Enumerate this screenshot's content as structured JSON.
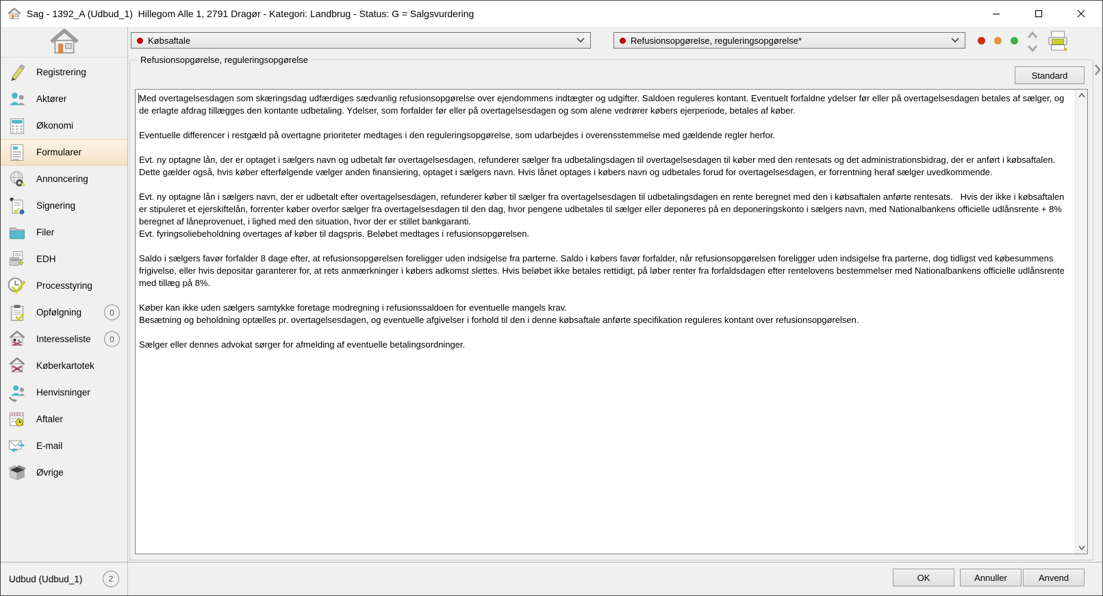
{
  "window": {
    "title": "Sag - 1392_A (Udbud_1)  Hillegom Alle 1, 2791 Dragør - Kategori: Landbrug - Status: G = Salgsvurdering"
  },
  "sidebar": {
    "items": [
      {
        "label": "Registrering",
        "icon": "pen-icon"
      },
      {
        "label": "Aktører",
        "icon": "people-icon"
      },
      {
        "label": "Økonomi",
        "icon": "calculator-icon"
      },
      {
        "label": "Formularer",
        "icon": "form-icon",
        "selected": true
      },
      {
        "label": "Annoncering",
        "icon": "globe-gear-icon"
      },
      {
        "label": "Signering",
        "icon": "signature-icon"
      },
      {
        "label": "Filer",
        "icon": "folder-icon"
      },
      {
        "label": "EDH",
        "icon": "printer-doc-icon"
      },
      {
        "label": "Processtyring",
        "icon": "clock-check-icon"
      },
      {
        "label": "Opfølgning",
        "icon": "clipboard-check-icon",
        "badge": "0"
      },
      {
        "label": "Interesseliste",
        "icon": "house-people-icon",
        "badge": "0"
      },
      {
        "label": "Køberkartotek",
        "icon": "house-bow-icon"
      },
      {
        "label": "Henvisninger",
        "icon": "people-arrow-icon"
      },
      {
        "label": "Aftaler",
        "icon": "calendar-clock-icon"
      },
      {
        "label": "E-mail",
        "icon": "email-icon"
      },
      {
        "label": "Øvrige",
        "icon": "box-icon"
      }
    ],
    "footer": {
      "label": "Udbud (Udbud_1)",
      "badge": "2"
    }
  },
  "toolbar": {
    "dropdown_left": {
      "value": "Købsaftale",
      "marker_color": "#c00000"
    },
    "dropdown_right": {
      "value": "Refusionsopgørelse, reguleringsopgørelse*",
      "marker_color": "#c00000"
    },
    "status_dots": [
      {
        "name": "status-dot-red",
        "color": "#d22b15"
      },
      {
        "name": "status-dot-orange",
        "color": "#e09a3e"
      },
      {
        "name": "status-dot-green",
        "color": "#3cb043"
      }
    ],
    "icons": [
      "chevron-up-icon",
      "chevron-down-icon",
      "printer-icon"
    ]
  },
  "main": {
    "groupbox_title": "Refusionsopgørelse, reguleringsopgørelse",
    "standard_button": "Standard",
    "editor_text": "Med overtagelsesdagen som skæringsdag udfærdiges sædvanlig refusionsopgørelse over ejendommens indtægter og udgifter. Saldoen reguleres kontant. Eventuelt forfaldne ydelser før eller på overtagelsesdagen betales af sælger, og de erlagte afdrag tillægges den kontante udbetaling. Ydelser, som forfalder før eller på overtagelsesdagen og som alene vedrører købers ejerperiode, betales af køber.\n\nEventuelle differencer i restgæld på overtagne prioriteter medtages i den reguleringsopgørelse, som udarbejdes i overensstemmelse med gældende regler herfor.\n\nEvt. ny optagne lån, der er optaget i sælgers navn og udbetalt før overtagelsesdagen, refunderer sælger fra udbetalingsdagen til overtagelsesdagen til køber med den rentesats og det administrationsbidrag, der er anført i købsaftalen. Dette gælder også, hvis køber efterfølgende vælger anden finansiering, optaget i sælgers navn. Hvis lånet optages i købers navn og udbetales forud for overtagelsesdagen, er forrentning heraf sælger uvedkommende.\n\nEvt. ny optagne lån i sælgers navn, der er udbetalt efter overtagelsesdagen, refunderer køber til sælger fra overtagelsesdagen til udbetalingsdagen en rente beregnet med den i købsaftalen anførte rentesats.   Hvis der ikke i købsaftalen er stipuleret et ejerskiftelån, forrenter køber overfor sælger fra overtagelsesdagen til den dag, hvor pengene udbetales til sælger eller deponeres på en deponeringskonto i sælgers navn, med Nationalbankens officielle udlånsrente + 8% beregnet af låneprovenuet, i lighed med den situation, hvor der er stillet bankgaranti.\nEvt. fyringsoliebeholdning overtages af køber til dagspris. Beløbet medtages i refusionsopgørelsen.\n\nSaldo i sælgers favør forfalder 8 dage efter, at refusionsopgørelsen foreligger uden indsigelse fra parterne. Saldo i købers favør forfalder, når refusionsopgørelsen foreligger uden indsigelse fra parterne, dog tidligst ved købesummens frigivelse, eller hvis depositar garanterer for, at rets anmærkninger i købers adkomst slettes. Hvis beløbet ikke betales rettidigt, på løber renter fra forfaldsdagen efter rentelovens bestemmelser med Nationalbankens officielle udlånsrente med tillæg på 8%.\n\nKøber kan ikke uden sælgers samtykke foretage modregning i refusionssaldoen for eventuelle mangels krav.\nBesætning og beholdning optælles pr. overtagelsesdagen, og eventuelle afgivelser i forhold til den i denne købsaftale anførte specifikation reguleres kontant over refusionsopgørelsen.\n\nSælger eller dennes advokat sørger for afmelding af eventuelle betalingsordninger."
  },
  "footer_buttons": {
    "ok": "OK",
    "cancel": "Annuller",
    "apply": "Anvend"
  }
}
